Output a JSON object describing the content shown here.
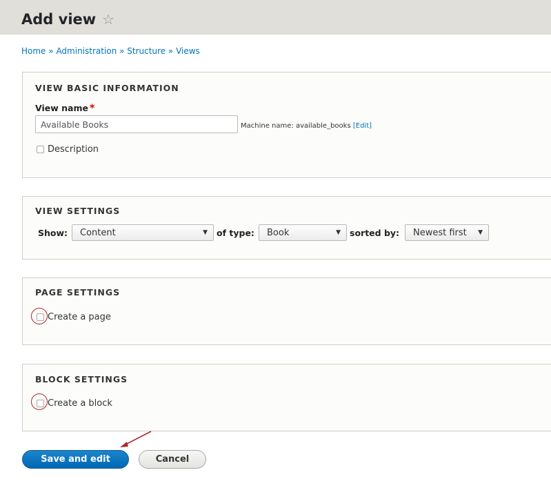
{
  "header": {
    "title": "Add view",
    "star_icon": "star-outline-icon"
  },
  "breadcrumb": {
    "items": [
      "Home",
      "Administration",
      "Structure",
      "Views"
    ],
    "separator": "»"
  },
  "basic_info": {
    "legend": "VIEW BASIC INFORMATION",
    "view_name_label": "View name",
    "required_marker": "*",
    "view_name_value": "Available Books",
    "machine_name_prefix": "Machine name: available_books",
    "machine_edit_link": "[Edit]",
    "description_label": "Description",
    "description_checked": false
  },
  "view_settings": {
    "legend": "VIEW SETTINGS",
    "show_label": "Show:",
    "show_value": "Content",
    "of_type_label": "of type:",
    "type_value": "Book",
    "sorted_by_label": "sorted by:",
    "sorted_value": "Newest first"
  },
  "page_settings": {
    "legend": "PAGE SETTINGS",
    "create_page_label": "Create a page",
    "checked": false
  },
  "block_settings": {
    "legend": "BLOCK SETTINGS",
    "create_block_label": "Create a block",
    "checked": false
  },
  "actions": {
    "save_label": "Save and edit",
    "cancel_label": "Cancel"
  },
  "colors": {
    "link": "#0074bd",
    "primary_button": "#0074bd",
    "annotation": "#b3262a",
    "required": "#dd0000"
  }
}
